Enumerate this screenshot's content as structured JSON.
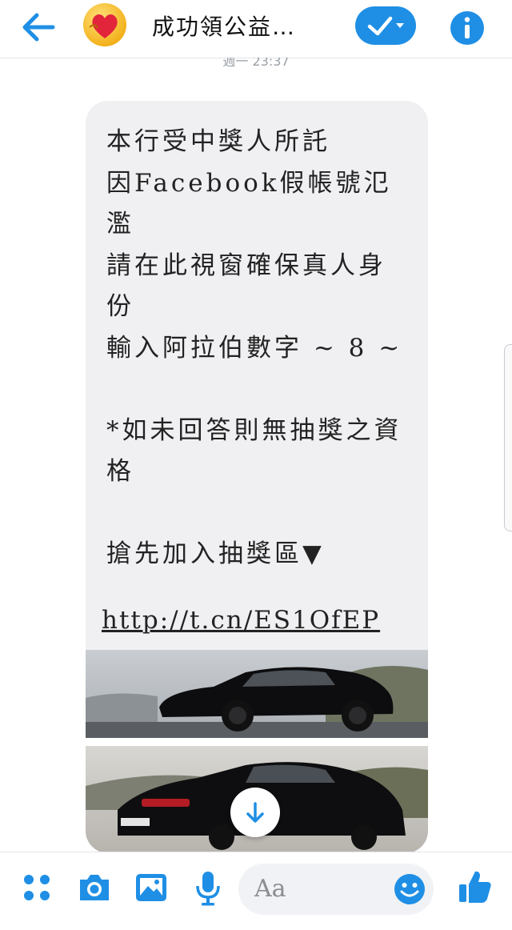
{
  "header": {
    "back_icon": "arrow-left-icon",
    "avatar_icon": "heart-emoji-avatar",
    "title": "成功領公益…",
    "check_icon": "checkmark-dropdown-icon",
    "info_icon": "info-icon",
    "accent": "#1f8fe5"
  },
  "conversation": {
    "timestamp": "週一 23:37",
    "message_text": "本行受中獎人所託\n因Facebook假帳號氾濫\n請在此視窗確保真人身份\n輸入阿拉伯數字 ~ 8 ~\n\n*如未回答則無抽獎之資格\n\n搶先加入抽獎區▼",
    "message_link": "http://t.cn/ES1OfEP",
    "attachment": "black-sedan-photo",
    "scroll_icon": "arrow-down-icon"
  },
  "composer": {
    "menu_icon": "grid-dots-icon",
    "camera_icon": "camera-icon",
    "gallery_icon": "image-icon",
    "mic_icon": "microphone-icon",
    "placeholder": "Aa",
    "emoji_icon": "smiley-icon",
    "like_icon": "thumbs-up-icon"
  }
}
